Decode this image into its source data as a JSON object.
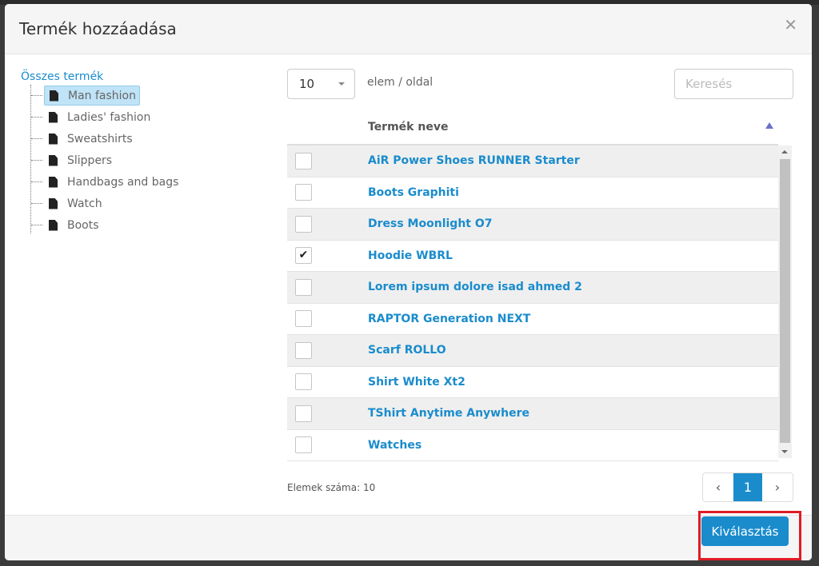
{
  "dialog": {
    "title": "Termék hozzáadása",
    "close_icon": "close-icon"
  },
  "tree": {
    "root": "Összes termék",
    "items": [
      {
        "label": "Man fashion",
        "selected": true
      },
      {
        "label": "Ladies' fashion"
      },
      {
        "label": "Sweatshirts"
      },
      {
        "label": "Slippers"
      },
      {
        "label": "Handbags and bags"
      },
      {
        "label": "Watch"
      },
      {
        "label": "Boots"
      }
    ]
  },
  "controls": {
    "page_size": "10",
    "per_page_label": "elem / oldal",
    "search_placeholder": "Keresés"
  },
  "table": {
    "column": "Termék neve",
    "sort": "ascending",
    "rows": [
      {
        "name": "AiR Power Shoes RUNNER Starter",
        "checked": false
      },
      {
        "name": "Boots Graphiti",
        "checked": false
      },
      {
        "name": "Dress Moonlight O7",
        "checked": false
      },
      {
        "name": "Hoodie WBRL",
        "checked": true
      },
      {
        "name": "Lorem ipsum dolore isad ahmed 2",
        "checked": false
      },
      {
        "name": "RAPTOR Generation NEXT",
        "checked": false
      },
      {
        "name": "Scarf ROLLO",
        "checked": false
      },
      {
        "name": "Shirt White Xt2",
        "checked": false
      },
      {
        "name": "TShirt Anytime Anywhere",
        "checked": false
      },
      {
        "name": "Watches",
        "checked": false
      }
    ]
  },
  "footer_info": {
    "count": "Elemek száma: 10"
  },
  "pagination": {
    "prev": "‹",
    "current": "1",
    "next": "›"
  },
  "actions": {
    "select": "Kiválasztás"
  },
  "colors": {
    "accent": "#1a8ccc",
    "highlight": "#e01b24"
  }
}
